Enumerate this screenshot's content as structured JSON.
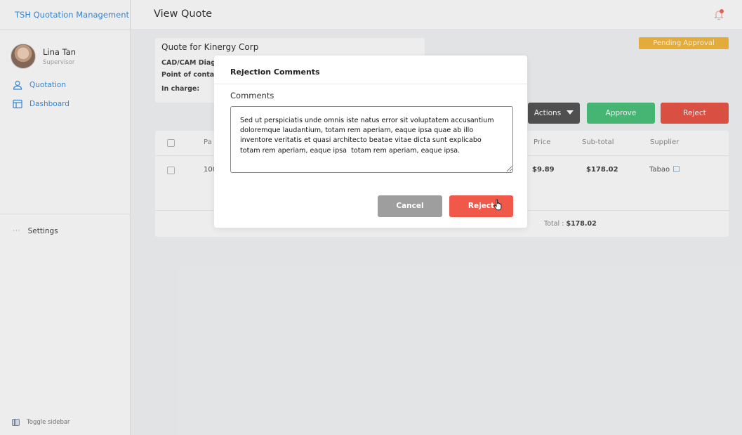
{
  "app": {
    "title": "TSH Quotation Management"
  },
  "user": {
    "name": "Lina Tan",
    "role": "Supervisor"
  },
  "sidebar": {
    "items": [
      {
        "label": "Quotation",
        "icon": "user-icon"
      },
      {
        "label": "Dashboard",
        "icon": "layout-icon"
      }
    ],
    "settings_label": "Settings",
    "toggle_label": "Toggle sidebar"
  },
  "header": {
    "title": "View Quote"
  },
  "quote": {
    "title": "Quote for Kinergy Corp",
    "line1": "CAD/CAM Diag",
    "line2": "Point of contac",
    "line3": "In charge:"
  },
  "status_badge": "Pending Approval",
  "toolbar": {
    "actions_label": "Actions",
    "approve_label": "Approve",
    "reject_label": "Reject"
  },
  "table": {
    "headers": {
      "part": "Pa",
      "price": "Price",
      "subtotal": "Sub-total",
      "supplier": "Supplier"
    },
    "row": {
      "part": "100",
      "price": "$9.89",
      "subtotal": "$178.02",
      "supplier": "Tabao"
    },
    "total_label": "Total :",
    "total_value": "$178.02"
  },
  "modal": {
    "title": "Rejection Comments",
    "comments_label": "Comments",
    "comments_value": "Sed ut perspiciatis unde omnis iste natus error sit voluptatem accusantium doloremque laudantium, totam rem aperiam, eaque ipsa quae ab illo inventore veritatis et quasi architecto beatae vitae dicta sunt explicabo totam rem aperiam, eaque ipsa  totam rem aperiam, eaque ipsa.",
    "cancel_label": "Cancel",
    "reject_label": "Reject"
  },
  "colors": {
    "accent": "#3a8fe0",
    "pending": "#f5b83d",
    "approve": "#4cc37c",
    "reject": "#ea5548",
    "cancel": "#9e9e9e"
  }
}
